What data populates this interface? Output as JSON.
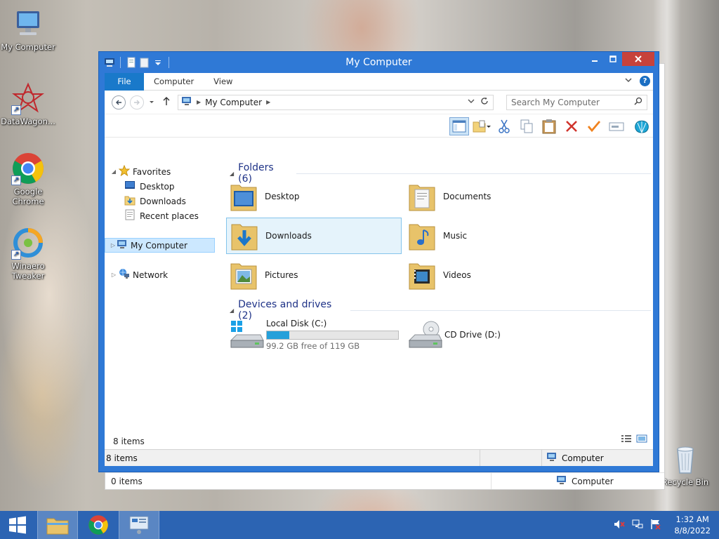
{
  "desktop": {
    "icons": [
      {
        "label": "My Computer"
      },
      {
        "label": "DataWagon..."
      },
      {
        "label": "Google Chrome"
      },
      {
        "label": "Winaero Tweaker"
      },
      {
        "label": "Recycle Bin"
      }
    ]
  },
  "back_window": {
    "status_left": "0 items",
    "status_right": "Computer"
  },
  "window": {
    "title": "My Computer",
    "tabs": [
      {
        "label": "File"
      },
      {
        "label": "Computer"
      },
      {
        "label": "View"
      }
    ],
    "address": {
      "path_item": "My Computer"
    },
    "search": {
      "placeholder": "Search My Computer"
    },
    "nav": {
      "favorites": "Favorites",
      "desktop": "Desktop",
      "downloads": "Downloads",
      "recent": "Recent places",
      "my_computer": "My Computer",
      "network": "Network"
    },
    "folders_group": "Folders (6)",
    "folders": [
      {
        "label": "Desktop"
      },
      {
        "label": "Documents"
      },
      {
        "label": "Downloads"
      },
      {
        "label": "Music"
      },
      {
        "label": "Pictures"
      },
      {
        "label": "Videos"
      }
    ],
    "drives_group": "Devices and drives (2)",
    "drives": [
      {
        "label": "Local Disk (C:)",
        "free_text": "99.2 GB free of 119 GB",
        "used_fraction": 0.17
      },
      {
        "label": "CD Drive (D:)"
      }
    ],
    "status_inner": "8 items",
    "status_left": "8 items",
    "status_right": "Computer"
  },
  "taskbar": {
    "time": "1:32 AM",
    "date": "8/8/2022"
  },
  "colors": {
    "title_bar": "#2f79d6",
    "close_button": "#c7423b",
    "file_tab": "#1979ca",
    "taskbar": "#2c64b3",
    "drive_fill": "#26a0da"
  }
}
